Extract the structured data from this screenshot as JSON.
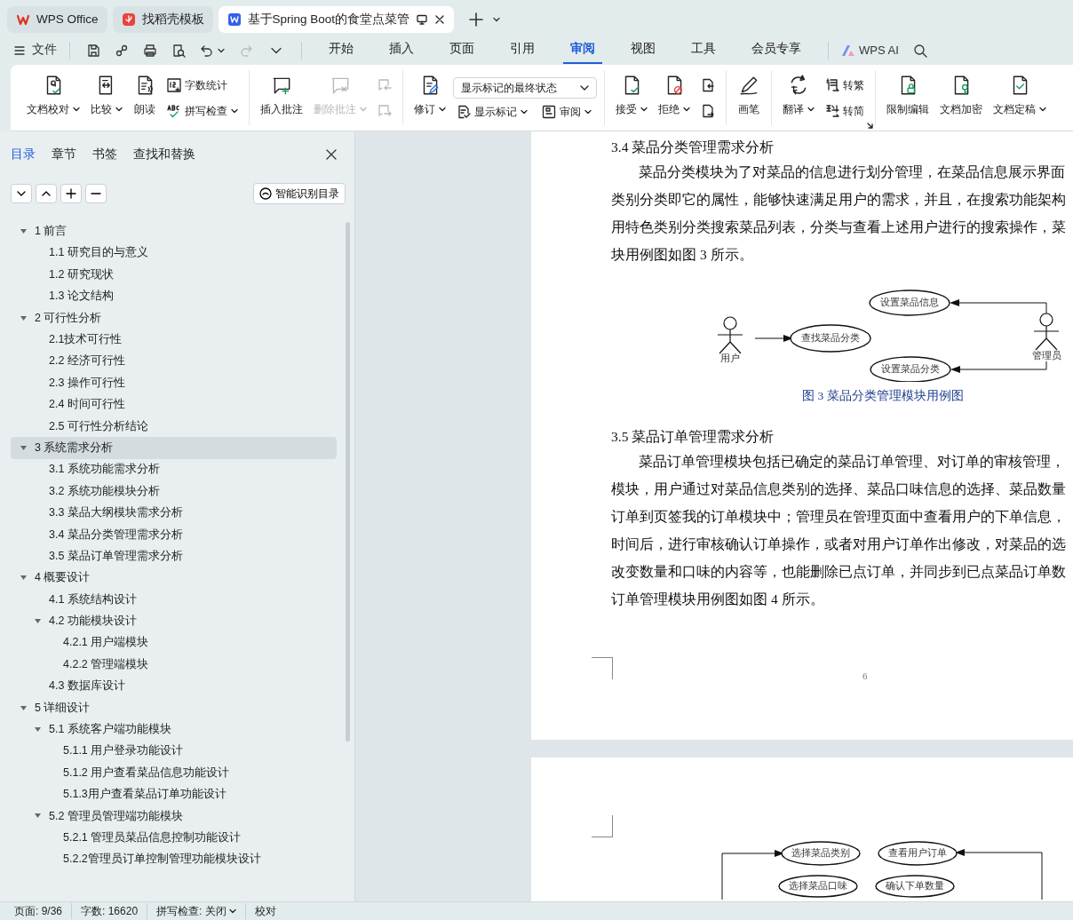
{
  "tabs": [
    {
      "label": "WPS Office",
      "selected": false
    },
    {
      "label": "找稻壳模板",
      "selected": false
    },
    {
      "label": "基于Spring Boot的食堂点菜管",
      "selected": true
    }
  ],
  "menu": {
    "file": "文件",
    "ai": "WPS AI",
    "tabs": [
      {
        "label": "开始",
        "selected": false
      },
      {
        "label": "插入",
        "selected": false
      },
      {
        "label": "页面",
        "selected": false
      },
      {
        "label": "引用",
        "selected": false
      },
      {
        "label": "审阅",
        "selected": true
      },
      {
        "label": "视图",
        "selected": false
      },
      {
        "label": "工具",
        "selected": false
      },
      {
        "label": "会员专享",
        "selected": false
      }
    ]
  },
  "ribbon": {
    "groups": [
      {
        "launcher": false,
        "items": [
          {
            "kind": "large",
            "label": "文档校对",
            "dropdown": true,
            "disabled": false
          },
          {
            "kind": "large",
            "label": "比较",
            "dropdown": true,
            "disabled": false
          },
          {
            "kind": "large",
            "label": "朗读",
            "dropdown": false,
            "disabled": false
          },
          {
            "kind": "stack",
            "items": [
              {
                "label": "字数统计",
                "dropdown": false,
                "disabled": false
              },
              {
                "label": "拼写检查",
                "dropdown": true,
                "disabled": false
              }
            ]
          }
        ]
      },
      {
        "launcher": false,
        "items": [
          {
            "kind": "large",
            "label": "插入批注",
            "dropdown": false,
            "disabled": false
          },
          {
            "kind": "large",
            "label": "删除批注",
            "dropdown": true,
            "disabled": true
          },
          {
            "kind": "stack",
            "items": [
              {
                "dropdown": false,
                "disabled": true
              },
              {
                "dropdown": false,
                "disabled": true
              }
            ]
          }
        ]
      },
      {
        "launcher": false,
        "items": [
          {
            "kind": "large",
            "label": "修订",
            "dropdown": true,
            "disabled": false
          },
          {
            "kind": "select",
            "value": "显示标记的最终状态",
            "items": [
              {
                "label": "显示标记",
                "dropdown": true,
                "disabled": false
              },
              {
                "label": "审阅",
                "dropdown": true,
                "disabled": false
              }
            ]
          }
        ]
      },
      {
        "launcher": false,
        "items": [
          {
            "kind": "large",
            "label": "接受",
            "dropdown": true,
            "disabled": false
          },
          {
            "kind": "large",
            "label": "拒绝",
            "dropdown": true,
            "disabled": false
          },
          {
            "kind": "stack",
            "items": [
              {
                "dropdown": false,
                "disabled": false
              },
              {
                "dropdown": false,
                "disabled": false
              }
            ]
          }
        ]
      },
      {
        "launcher": false,
        "items": [
          {
            "kind": "large",
            "label": "画笔",
            "dropdown": false,
            "disabled": false
          }
        ]
      },
      {
        "launcher": true,
        "items": [
          {
            "kind": "large",
            "label": "翻译",
            "dropdown": true,
            "disabled": false
          },
          {
            "kind": "stack",
            "items": [
              {
                "label": "转繁",
                "dropdown": false,
                "disabled": false
              },
              {
                "label": "转简",
                "dropdown": false,
                "disabled": false
              }
            ]
          }
        ]
      },
      {
        "launcher": false,
        "items": [
          {
            "kind": "large",
            "label": "限制编辑",
            "dropdown": false,
            "disabled": false
          },
          {
            "kind": "large",
            "label": "文档加密",
            "dropdown": false,
            "disabled": false
          },
          {
            "kind": "large",
            "label": "文档定稿",
            "dropdown": true,
            "disabled": false
          }
        ]
      }
    ]
  },
  "sidebar": {
    "tabs": [
      {
        "label": "目录",
        "selected": true
      },
      {
        "label": "章节",
        "selected": false
      },
      {
        "label": "书签",
        "selected": false
      },
      {
        "label": "查找和替换",
        "selected": false
      }
    ],
    "smart_button": "智能识别目录",
    "toc": [
      {
        "label": "1 前言",
        "selected": false,
        "expanded": true,
        "children": [
          {
            "label": "1.1 研究目的与意义",
            "selected": false
          },
          {
            "label": "1.2 研究现状",
            "selected": false
          },
          {
            "label": "1.3 论文结构",
            "selected": false
          }
        ]
      },
      {
        "label": "2 可行性分析",
        "selected": false,
        "expanded": true,
        "children": [
          {
            "label": "2.1技术可行性",
            "selected": false
          },
          {
            "label": "2.2 经济可行性",
            "selected": false
          },
          {
            "label": "2.3 操作可行性",
            "selected": false
          },
          {
            "label": "2.4 时间可行性",
            "selected": false
          },
          {
            "label": "2.5 可行性分析结论",
            "selected": false
          }
        ]
      },
      {
        "label": "3 系统需求分析",
        "selected": true,
        "expanded": true,
        "children": [
          {
            "label": "3.1 系统功能需求分析",
            "selected": false
          },
          {
            "label": "3.2 系统功能模块分析",
            "selected": false
          },
          {
            "label": "3.3 菜品大纲模块需求分析",
            "selected": false
          },
          {
            "label": "3.4 菜品分类管理需求分析",
            "selected": false
          },
          {
            "label": "3.5 菜品订单管理需求分析",
            "selected": false
          }
        ]
      },
      {
        "label": "4 概要设计",
        "selected": false,
        "expanded": true,
        "children": [
          {
            "label": "4.1 系统结构设计",
            "selected": false
          },
          {
            "label": "4.2 功能模块设计",
            "selected": false,
            "expanded": true,
            "children": [
              {
                "label": "4.2.1 用户端模块",
                "selected": false
              },
              {
                "label": "4.2.2 管理端模块",
                "selected": false
              }
            ]
          },
          {
            "label": "4.3 数据库设计",
            "selected": false
          }
        ]
      },
      {
        "label": "5 详细设计",
        "selected": false,
        "expanded": true,
        "children": [
          {
            "label": "5.1 系统客户端功能模块",
            "selected": false,
            "expanded": true,
            "children": [
              {
                "label": "5.1.1 用户登录功能设计",
                "selected": false
              },
              {
                "label": "5.1.2 用户查看菜品信息功能设计",
                "selected": false
              },
              {
                "label": "5.1.3用户查看菜品订单功能设计",
                "selected": false
              }
            ]
          },
          {
            "label": "5.2 管理员管理端功能模块",
            "selected": false,
            "expanded": true,
            "children": [
              {
                "label": "5.2.1 管理员菜品信息控制功能设计",
                "selected": false
              },
              {
                "label": "5.2.2管理员订单控制管理功能模块设计",
                "selected": false
              }
            ]
          }
        ]
      }
    ]
  },
  "document": {
    "pages": [
      {
        "page_number": "6",
        "blocks": [
          {
            "kind": "heading",
            "text": "3.4 菜品分类管理需求分析"
          },
          {
            "kind": "paragraph",
            "lines": [
              "菜品分类模块为了对菜品的信息进行划分管理，在菜品信息展示界面",
              "类别分类即它的属性，能够快速满足用户的需求，并且，在搜索功能架构",
              "用特色类别分类搜索菜品列表，分类与查看上述用户进行的搜索操作，菜",
              "块用例图如图 3 所示。"
            ]
          },
          {
            "kind": "figure",
            "actors": [
              "用户",
              "管理员"
            ],
            "use_cases": [
              "查找菜品分类",
              "设置菜品信息",
              "设置菜品分类"
            ]
          },
          {
            "kind": "caption",
            "text": "图 3 菜品分类管理模块用例图"
          },
          {
            "kind": "heading",
            "text": "3.5 菜品订单管理需求分析"
          },
          {
            "kind": "paragraph",
            "lines": [
              "菜品订单管理模块包括已确定的菜品订单管理、对订单的审核管理，",
              "模块，用户通过对菜品信息类别的选择、菜品口味信息的选择、菜品数量",
              "订单到页签我的订单模块中；管理员在管理页面中查看用户的下单信息，",
              "时间后，进行审核确认订单操作，或者对用户订单作出修改，对菜品的选",
              "改变数量和口味的内容等，也能删除已点订单，并同步到已点菜品订单数",
              "订单管理模块用例图如图 4 所示。"
            ]
          }
        ]
      },
      {
        "blocks": [
          {
            "kind": "figure",
            "use_cases": [
              "选择菜品类别",
              "查看用户订单",
              "选择菜品口味",
              "确认下单数量"
            ]
          }
        ]
      }
    ]
  },
  "status_bar": {
    "page": "页面: 9/36",
    "words": "字数: 16620",
    "spell": "拼写检查: 关闭",
    "proofread": "校对"
  }
}
